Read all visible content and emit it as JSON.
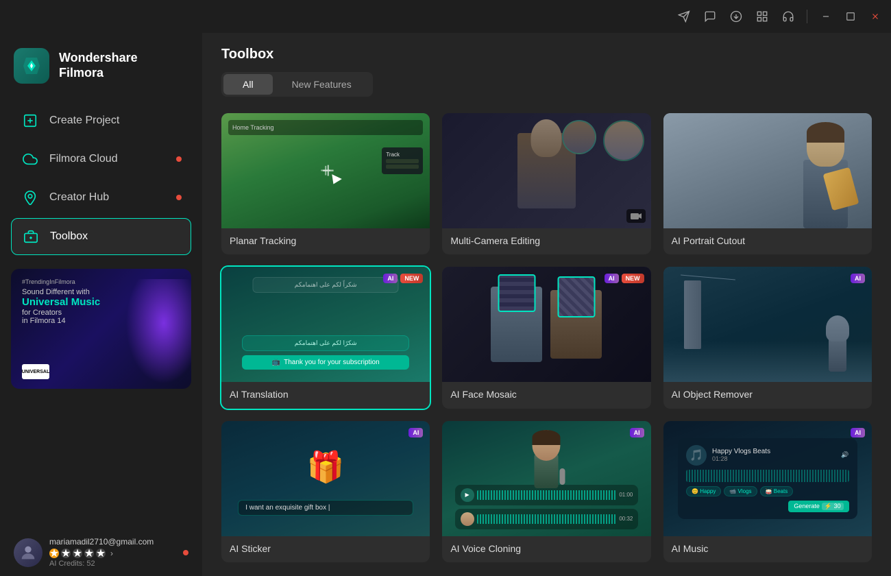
{
  "titlebar": {
    "icons": [
      "send-icon",
      "chat-icon",
      "download-icon",
      "grid-icon",
      "headset-icon"
    ],
    "controls": [
      "minimize-btn",
      "maximize-btn",
      "close-btn"
    ]
  },
  "app": {
    "name": "Wondershare",
    "product": "Filmora"
  },
  "sidebar": {
    "nav_items": [
      {
        "id": "create-project",
        "label": "Create Project",
        "icon": "plus-square-icon",
        "dot": false
      },
      {
        "id": "filmora-cloud",
        "label": "Filmora Cloud",
        "icon": "cloud-icon",
        "dot": true
      },
      {
        "id": "creator-hub",
        "label": "Creator Hub",
        "icon": "location-icon",
        "dot": true
      },
      {
        "id": "toolbox",
        "label": "Toolbox",
        "icon": "toolbox-icon",
        "dot": false,
        "active": true
      }
    ],
    "banner": {
      "hashtag": "#TrendingInFilmora",
      "line1": "Sound Different with",
      "line2": "Universal Music",
      "line3": "for Creators",
      "line4": "in Filmora 14"
    },
    "profile": {
      "email": "mariamadil2710@gmail.com",
      "credits_label": "AI Credits: 52"
    }
  },
  "main": {
    "title": "Toolbox",
    "tabs": [
      {
        "id": "all",
        "label": "All",
        "active": true
      },
      {
        "id": "new-features",
        "label": "New Features",
        "active": false
      }
    ],
    "tools": [
      {
        "id": "planar-tracking",
        "label": "Planar Tracking",
        "thumb_type": "planar",
        "badges": [],
        "selected": false
      },
      {
        "id": "multi-camera-editing",
        "label": "Multi-Camera Editing",
        "thumb_type": "multicam",
        "badges": [],
        "selected": false
      },
      {
        "id": "ai-portrait-cutout",
        "label": "AI Portrait Cutout",
        "thumb_type": "portrait",
        "badges": [],
        "selected": false
      },
      {
        "id": "ai-translation",
        "label": "AI Translation",
        "thumb_type": "translation",
        "badges": [
          "AI",
          "NEW"
        ],
        "selected": true
      },
      {
        "id": "ai-face-mosaic",
        "label": "AI Face Mosaic",
        "thumb_type": "facemosaic",
        "badges": [
          "AI",
          "NEW"
        ],
        "selected": false
      },
      {
        "id": "ai-object-remover",
        "label": "AI Object Remover",
        "thumb_type": "objectremover",
        "badges": [
          "AI"
        ],
        "selected": false
      },
      {
        "id": "ai-sticker",
        "label": "AI Sticker",
        "thumb_type": "sticker",
        "badges": [
          "AI"
        ],
        "selected": false
      },
      {
        "id": "ai-voice-cloning",
        "label": "AI Voice Cloning",
        "thumb_type": "voicecloning",
        "badges": [
          "AI"
        ],
        "selected": false
      },
      {
        "id": "ai-music",
        "label": "AI Music",
        "thumb_type": "music",
        "badges": [
          "AI"
        ],
        "selected": false
      }
    ]
  }
}
